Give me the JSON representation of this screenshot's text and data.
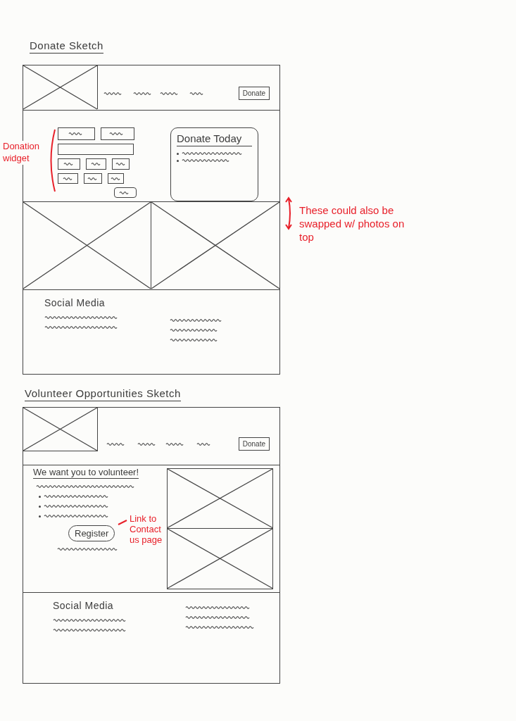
{
  "donate_sketch": {
    "title": "Donate Sketch",
    "header": {
      "button": "Donate"
    },
    "donation_widget": {
      "annotation": "Donation widget"
    },
    "donate_today_card": {
      "title": "Donate Today"
    },
    "images": {
      "annotation": "These could also be swapped w/ photos on top"
    },
    "footer": {
      "heading": "Social Media"
    }
  },
  "volunteer_sketch": {
    "title": "Volunteer Opportunities Sketch",
    "header": {
      "button": "Donate"
    },
    "intro": {
      "heading": "We want you to volunteer!",
      "button": "Register",
      "annotation": "Link to Contact us page"
    },
    "footer": {
      "heading": "Social Media"
    }
  }
}
